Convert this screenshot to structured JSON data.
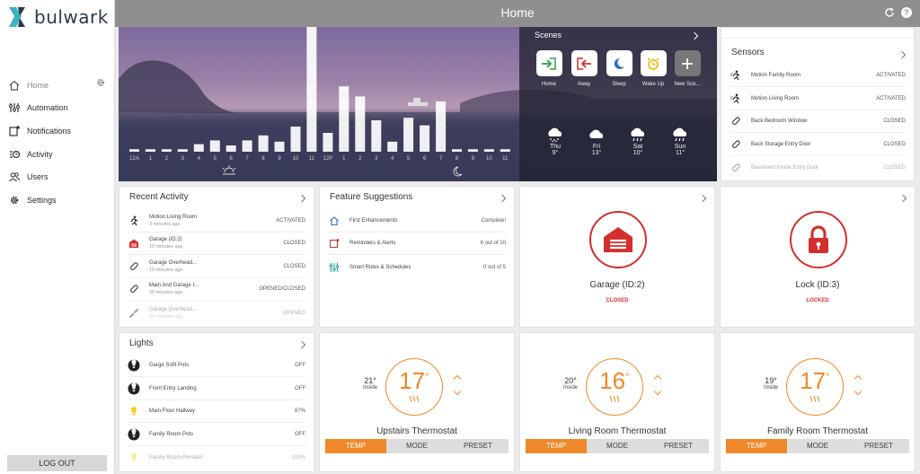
{
  "app": {
    "brand": "bulwark",
    "title": "Home",
    "accent": "#f0882a",
    "alert": "#d32f2f"
  },
  "nav": [
    {
      "label": "Home",
      "icon": "home-icon"
    },
    {
      "label": "Automation",
      "icon": "sliders-icon"
    },
    {
      "label": "Notifications",
      "icon": "notification-icon"
    },
    {
      "label": "Activity",
      "icon": "activity-icon"
    },
    {
      "label": "Users",
      "icon": "users-icon"
    },
    {
      "label": "Settings",
      "icon": "gear-icon"
    }
  ],
  "logout": "LOG OUT",
  "hero": {
    "hours": [
      "12A",
      "1",
      "2",
      "3",
      "4",
      "5",
      "6",
      "7",
      "8",
      "9",
      "10",
      "11",
      "12P",
      "1",
      "2",
      "3",
      "4",
      "5",
      "6",
      "7",
      "8",
      "9",
      "10",
      "11"
    ],
    "activity_levels": [
      0.02,
      0.02,
      0.02,
      0.02,
      0.06,
      0.09,
      0.05,
      0.09,
      0.13,
      0.08,
      0.2,
      1.0,
      0.15,
      0.52,
      0.44,
      0.25,
      0.08,
      0.27,
      0.21,
      0.4,
      0.02,
      0.02,
      0.02,
      0.02
    ]
  },
  "scenes": {
    "title": "Scenes",
    "items": [
      {
        "label": "Home",
        "icon": "arrive-home-icon"
      },
      {
        "label": "Away",
        "icon": "leave-home-icon"
      },
      {
        "label": "Sleep",
        "icon": "moon-icon"
      },
      {
        "label": "Wake Up",
        "icon": "alarm-clock-icon"
      },
      {
        "label": "New Sce...",
        "icon": "plus-icon"
      }
    ]
  },
  "weather": [
    {
      "day": "Thu",
      "temp": "9°",
      "icon": "snow-icon"
    },
    {
      "day": "Fri",
      "temp": "13°",
      "icon": "cloud-icon"
    },
    {
      "day": "Sat",
      "temp": "10°",
      "icon": "rain-icon"
    },
    {
      "day": "Sun",
      "temp": "11°",
      "icon": "rain-icon"
    }
  ],
  "sensors": {
    "title": "Sensors",
    "items": [
      {
        "name": "Motion Family Room",
        "status": "ACTIVATED",
        "icon": "motion-icon"
      },
      {
        "name": "Motion Living Room",
        "status": "ACTIVATED",
        "icon": "motion-icon"
      },
      {
        "name": "Back Bedroom Window",
        "status": "CLOSED",
        "icon": "contact-sensor-icon"
      },
      {
        "name": "Back Storage Entry Door",
        "status": "CLOSED",
        "icon": "contact-sensor-icon"
      },
      {
        "name": "Basement Inside Entry Door",
        "status": "CLOSED",
        "icon": "contact-sensor-icon"
      }
    ]
  },
  "recent": {
    "title": "Recent Activity",
    "items": [
      {
        "name": "Motion Living Room",
        "time": "3 minutes ago",
        "status": "ACTIVATED",
        "icon": "motion-icon"
      },
      {
        "name": "Garage (ID:2)",
        "time": "19 minutes ago",
        "status": "CLOSED",
        "icon": "garage-icon"
      },
      {
        "name": "Garage Overhead...",
        "time": "19 minutes ago",
        "status": "CLOSED",
        "icon": "contact-sensor-icon"
      },
      {
        "name": "Main And Garage I...",
        "time": "20 minutes ago",
        "status": "OPENED/CLOSED",
        "icon": "contact-sensor-icon"
      },
      {
        "name": "Garage Overhead...",
        "time": "20 minutes ago",
        "status": "OPENED",
        "icon": "contact-open-icon"
      }
    ]
  },
  "features": {
    "title": "Feature Suggestions",
    "items": [
      {
        "name": "First Enhancements",
        "status": "Complete!",
        "icon": "house-outline-icon"
      },
      {
        "name": "Reminders & Alerts",
        "status": "6 out of 10",
        "icon": "reminder-icon"
      },
      {
        "name": "Smart Rules & Schedules",
        "status": "0 out of 5",
        "icon": "rules-icon"
      }
    ]
  },
  "garage": {
    "name": "Garage (ID:2)",
    "status": "CLOSED"
  },
  "lock": {
    "name": "Lock (ID:3)",
    "status": "LOCKED"
  },
  "lights": {
    "title": "Lights",
    "items": [
      {
        "name": "Garge Sofit Pots",
        "status": "OFF",
        "on": false
      },
      {
        "name": "Front Entry Landing",
        "status": "OFF",
        "on": false
      },
      {
        "name": "Main Floor Hallway",
        "status": "87%",
        "on": true
      },
      {
        "name": "Family Room Pots",
        "status": "OFF",
        "on": false
      },
      {
        "name": "Family Room Pendant",
        "status": "100%",
        "on": true
      }
    ]
  },
  "thermostats": [
    {
      "name": "Upstairs Thermostat",
      "inside": "21°",
      "inside_label": "Inside",
      "setpoint": "17",
      "deg": "°"
    },
    {
      "name": "Living Room Thermostat",
      "inside": "20°",
      "inside_label": "Inside",
      "setpoint": "16",
      "deg": "°"
    },
    {
      "name": "Family Room Thermostat",
      "inside": "19°",
      "inside_label": "Inside",
      "setpoint": "17",
      "deg": "°"
    }
  ],
  "thermo_tabs": [
    "TEMP",
    "MODE",
    "PRESET"
  ]
}
